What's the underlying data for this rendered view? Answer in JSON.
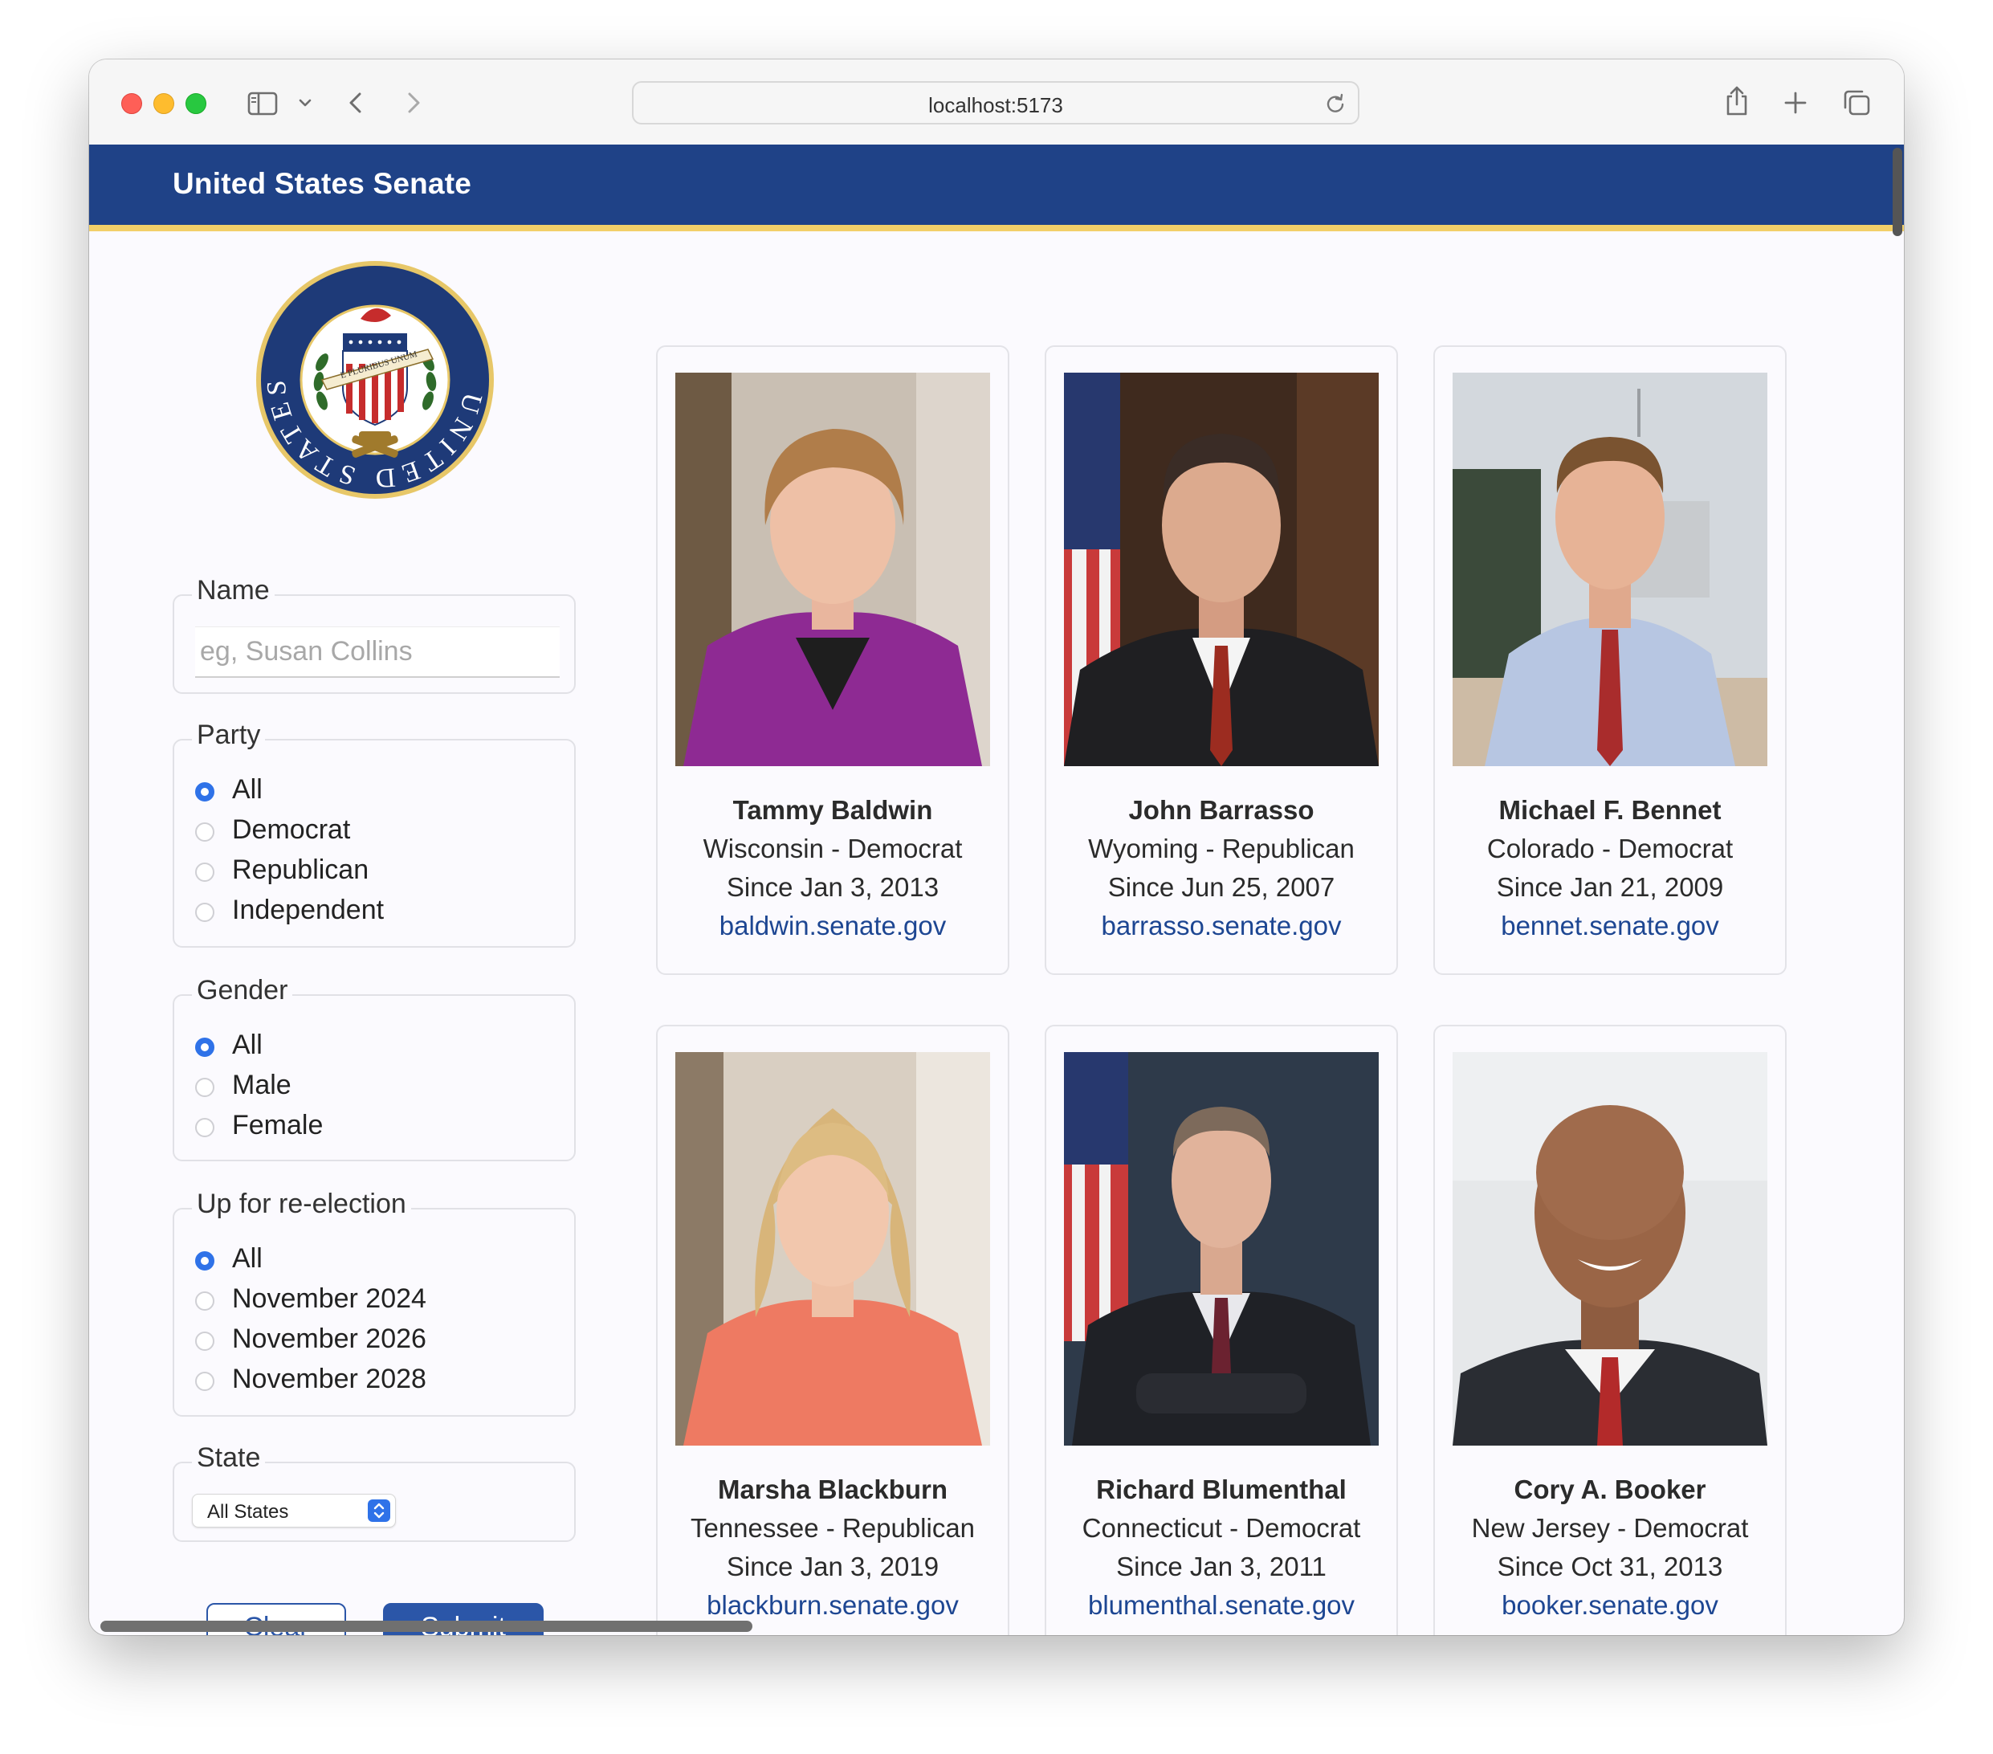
{
  "browser": {
    "url": "localhost:5173"
  },
  "header": {
    "title": "United States Senate"
  },
  "seal": {
    "ring_text": "UNITED STATES SENATE",
    "motto": "E PLURIBUS UNUM",
    "cap_text": "LIBERTY"
  },
  "filters": {
    "name": {
      "legend": "Name",
      "placeholder": "eg, Susan Collins",
      "value": ""
    },
    "party": {
      "legend": "Party",
      "options": [
        "All",
        "Democrat",
        "Republican",
        "Independent"
      ],
      "selected": "All"
    },
    "gender": {
      "legend": "Gender",
      "options": [
        "All",
        "Male",
        "Female"
      ],
      "selected": "All"
    },
    "reelection": {
      "legend": "Up for re-election",
      "options": [
        "All",
        "November 2024",
        "November 2026",
        "November 2028"
      ],
      "selected": "All"
    },
    "state": {
      "legend": "State",
      "selected": "All States"
    }
  },
  "buttons": {
    "clear": "Clear",
    "submit": "Submit"
  },
  "senators": [
    {
      "name": "Tammy Baldwin",
      "state_party": "Wisconsin - Democrat",
      "since": "Since Jan 3, 2013",
      "website": "baldwin.senate.gov"
    },
    {
      "name": "John Barrasso",
      "state_party": "Wyoming - Republican",
      "since": "Since Jun 25, 2007",
      "website": "barrasso.senate.gov"
    },
    {
      "name": "Michael F. Bennet",
      "state_party": "Colorado - Democrat",
      "since": "Since Jan 21, 2009",
      "website": "bennet.senate.gov"
    },
    {
      "name": "Marsha Blackburn",
      "state_party": "Tennessee - Republican",
      "since": "Since Jan 3, 2019",
      "website": "blackburn.senate.gov"
    },
    {
      "name": "Richard Blumenthal",
      "state_party": "Connecticut - Democrat",
      "since": "Since Jan 3, 2011",
      "website": "blumenthal.senate.gov"
    },
    {
      "name": "Cory A. Booker",
      "state_party": "New Jersey - Democrat",
      "since": "Since Oct 31, 2013",
      "website": "booker.senate.gov"
    }
  ],
  "colors": {
    "header": "#1f4287",
    "header_border": "#f2cf69",
    "link": "#1d4692",
    "radio_selected": "#2f72e8",
    "submit": "#2b56a8"
  },
  "icons": [
    "sidebar-icon",
    "chevron-down-icon",
    "back-icon",
    "forward-icon",
    "reload-icon",
    "share-icon",
    "plus-icon",
    "tabs-icon"
  ]
}
